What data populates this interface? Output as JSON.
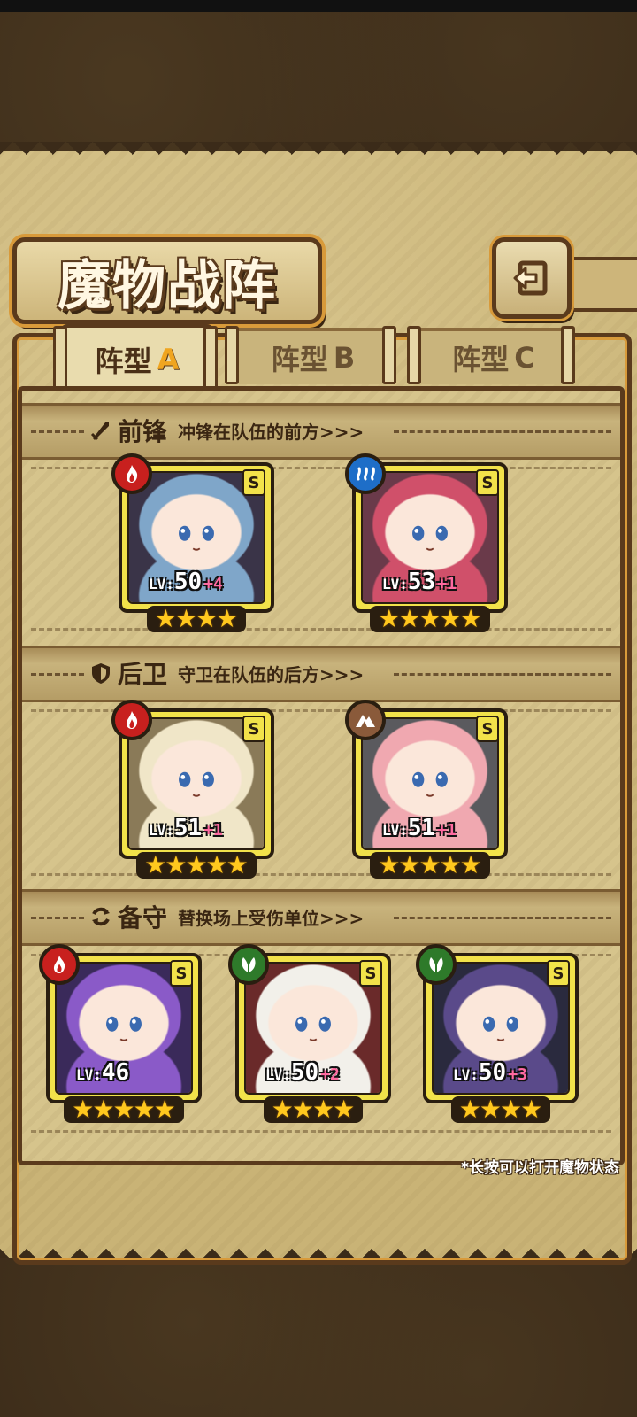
{
  "title": "魔物战阵",
  "tabs": [
    {
      "label": "阵型",
      "letter": "A",
      "active": true
    },
    {
      "label": "阵型",
      "letter": "B",
      "active": false
    },
    {
      "label": "阵型",
      "letter": "C",
      "active": false
    }
  ],
  "sections": {
    "front": {
      "title": "前锋",
      "subtitle": "冲锋在队伍的前方>>>",
      "icon": "sword-icon"
    },
    "back": {
      "title": "后卫",
      "subtitle": "守卫在队伍的后方>>>",
      "icon": "shield-icon"
    },
    "reserve": {
      "title": "备守",
      "subtitle": "替换场上受伤单位>>>",
      "icon": "swap-icon"
    }
  },
  "cards": {
    "front": [
      {
        "element": "fire",
        "grade": "S",
        "lv_label": "LV:",
        "level": "50",
        "plus": "+4",
        "stars": 4,
        "colors": [
          "#3a3448",
          "#7fa6c9"
        ]
      },
      {
        "element": "water",
        "grade": "S",
        "lv_label": "LV:",
        "level": "53",
        "plus": "+1",
        "stars": 5,
        "colors": [
          "#6a3a4a",
          "#d0506a"
        ]
      }
    ],
    "back": [
      {
        "element": "fire",
        "grade": "S",
        "lv_label": "LV:",
        "level": "51",
        "plus": "+1",
        "stars": 5,
        "colors": [
          "#8a7a58",
          "#f0e6c8"
        ]
      },
      {
        "element": "earth",
        "grade": "S",
        "lv_label": "LV:",
        "level": "51",
        "plus": "+1",
        "stars": 5,
        "colors": [
          "#5a5a5e",
          "#f0a8b0"
        ]
      }
    ],
    "reserve": [
      {
        "element": "fire",
        "grade": "S",
        "lv_label": "LV:",
        "level": "46",
        "plus": "",
        "stars": 5,
        "colors": [
          "#3a2a5a",
          "#8a5ac8"
        ]
      },
      {
        "element": "nature",
        "grade": "S",
        "lv_label": "LV:",
        "level": "50",
        "plus": "+2",
        "stars": 4,
        "colors": [
          "#6a2a2a",
          "#f2f0ea"
        ]
      },
      {
        "element": "nature",
        "grade": "S",
        "lv_label": "LV:",
        "level": "50",
        "plus": "+3",
        "stars": 4,
        "colors": [
          "#2a2a3e",
          "#5a4a8a"
        ]
      }
    ]
  },
  "footnote": "*长按可以打开魔物状态"
}
